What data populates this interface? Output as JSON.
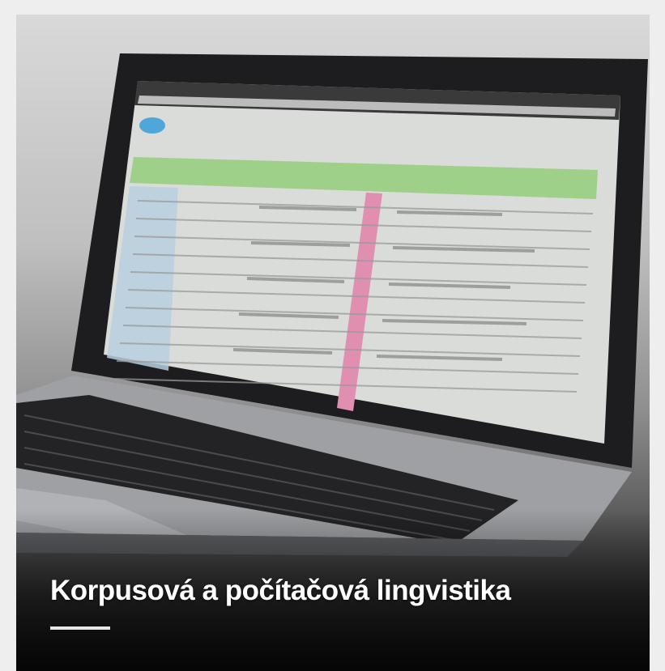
{
  "card": {
    "title": "Korpusová a počítačová lingvistika"
  },
  "colors": {
    "background": "#eeeeee",
    "title_text": "#ffffff",
    "screen_header_bar": "#9ed08a",
    "screen_highlight_column": "#e08fb0",
    "screen_accent_blue": "#4fa6d8"
  },
  "image": {
    "subject": "laptop-photo"
  }
}
